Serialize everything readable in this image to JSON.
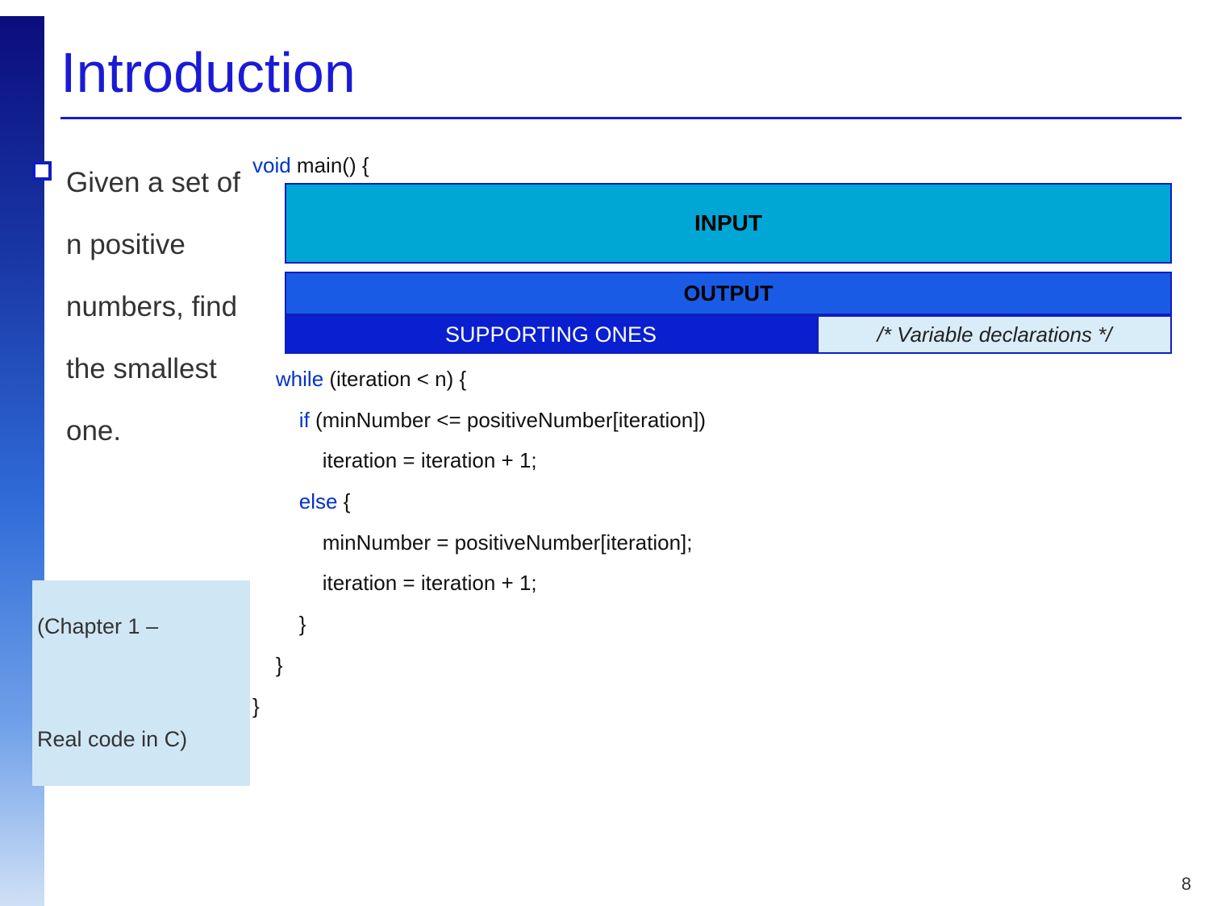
{
  "title": "Introduction",
  "bullet": "Given a set of n positive numbers, find the smallest one.",
  "chapter": "(Chapter 1 –\n\nReal code in C)",
  "code": {
    "sig_kw": "void",
    "sig_rest": " main() {",
    "box_input": "INPUT",
    "box_output": "OUTPUT",
    "box_support": "SUPPORTING ONES",
    "box_vardecl": "/* Variable declarations */",
    "while_kw": "while",
    "while_rest": " (iteration < n) {",
    "if_kw": "if",
    "if_rest": " (minNumber <= positiveNumber[iteration])",
    "if_body": "iteration = iteration + 1;",
    "else_kw": "else",
    "else_rest": " {",
    "else_body1": "minNumber = positiveNumber[iteration];",
    "else_body2": "iteration = iteration + 1;",
    "close1": "}",
    "close2": "}",
    "close3": "}"
  },
  "page_number": "8"
}
